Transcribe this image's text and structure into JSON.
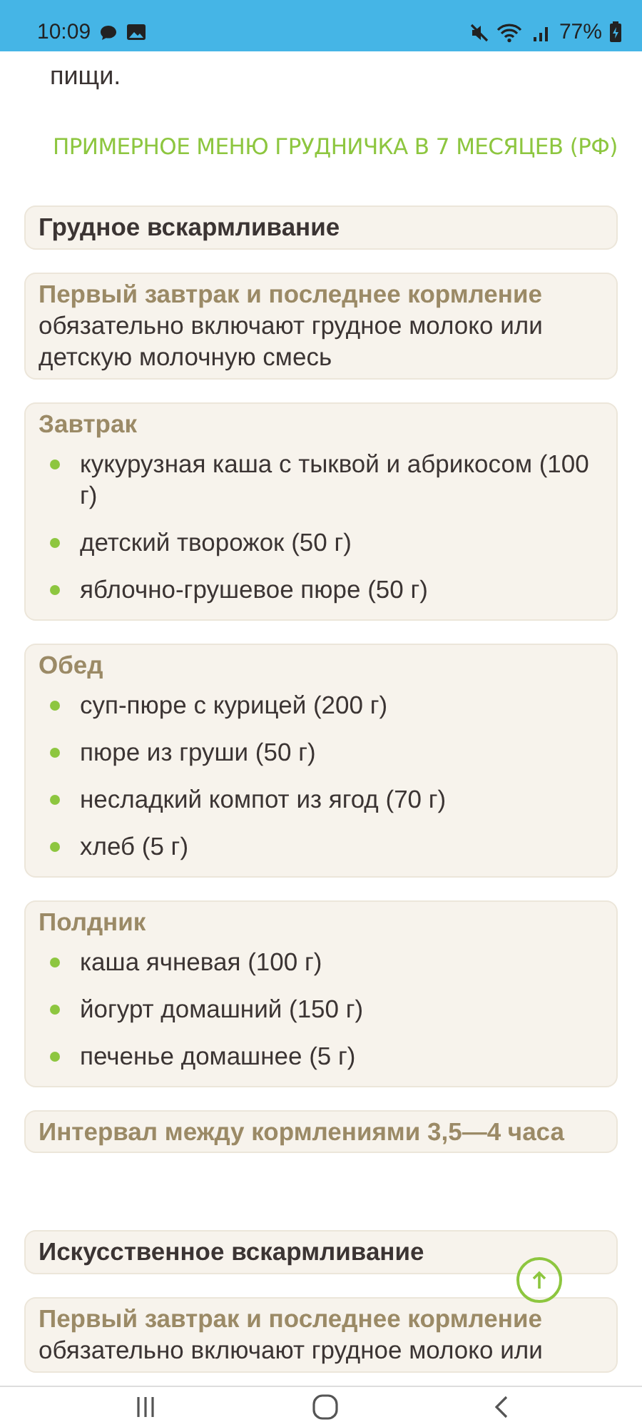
{
  "status_bar": {
    "time": "10:09",
    "battery": "77%"
  },
  "intro_text": "пищи.",
  "heading": "ПРИМЕРНОЕ МЕНЮ ГРУДНИЧКА В 7 МЕСЯЦЕВ (РФ)",
  "blocks": [
    {
      "kind": "section",
      "title": "Грудное вскармливание"
    },
    {
      "kind": "note",
      "title": "Первый завтрак и последнее кормление",
      "text": "обязательно включают грудное молоко или детскую молочную смесь"
    },
    {
      "kind": "meal",
      "title": "Завтрак",
      "items": [
        "кукурузная каша с тыквой и абрикосом (100 г)",
        "детский творожок (50 г)",
        "яблочно-грушевое пюре (50 г)"
      ]
    },
    {
      "kind": "meal",
      "title": "Обед",
      "items": [
        "суп-пюре с курицей (200 г)",
        "пюре из груши (50 г)",
        "несладкий компот из ягод (70 г)",
        "хлеб (5 г)"
      ]
    },
    {
      "kind": "meal",
      "title": "Полдник",
      "items": [
        "каша ячневая (100 г)",
        "йогурт домашний (150 г)",
        "печенье домашнее (5 г)"
      ]
    },
    {
      "kind": "interval",
      "title": "Интервал между кормлениями 3,5—4 часа"
    },
    {
      "kind": "section",
      "title": "Искусственное вскармливание"
    },
    {
      "kind": "note",
      "title": "Первый завтрак и последнее кормление",
      "text": "обязательно включают грудное молоко или"
    }
  ]
}
